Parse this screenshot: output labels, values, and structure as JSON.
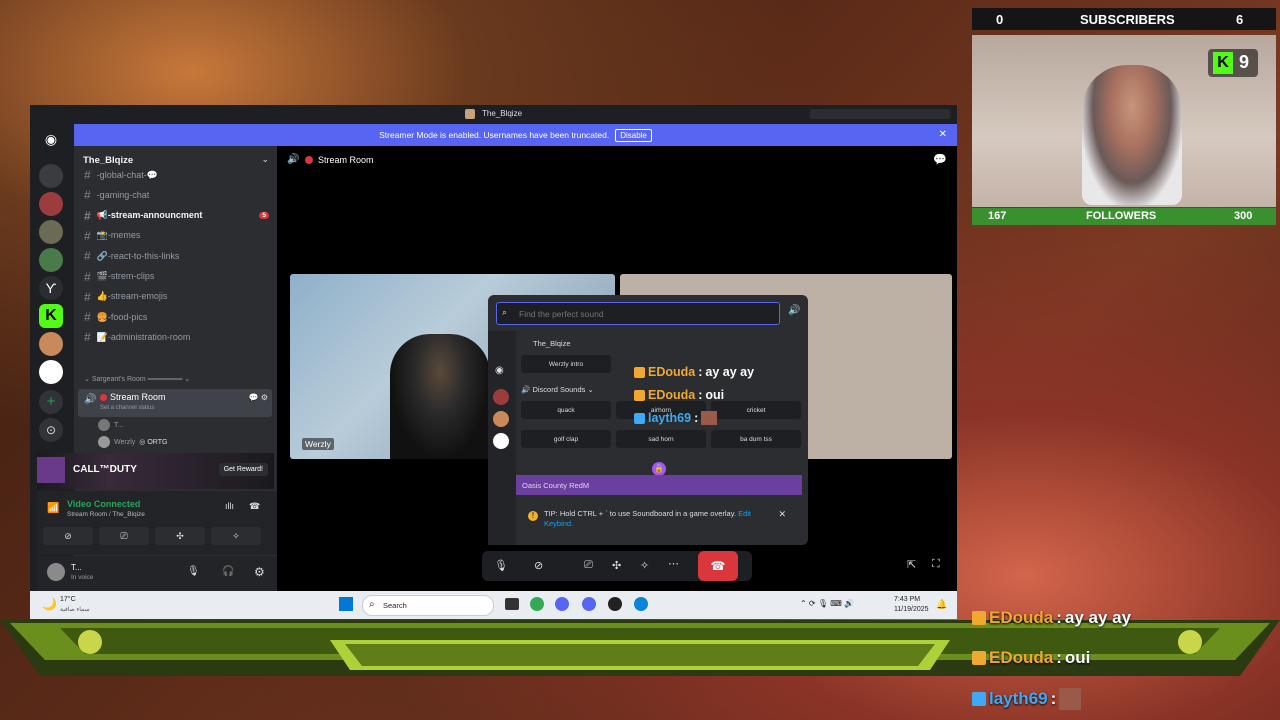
{
  "window_title": "The_Blqize",
  "banner": {
    "text": "Streamer Mode is enabled. Usernames have been truncated.",
    "button": "Disable"
  },
  "server_name": "The_Blqize",
  "channels": [
    {
      "label": "-global-chat-💬",
      "bold": false
    },
    {
      "label": "-gaming-chat",
      "bold": false
    },
    {
      "label": "📢-stream-announcment",
      "bold": true,
      "badge": "5"
    },
    {
      "label": "📸-memes",
      "bold": false
    },
    {
      "label": "🔗-react-to-this-links",
      "bold": false
    },
    {
      "label": "🎬-strem-clips",
      "bold": false
    },
    {
      "label": "👍-stream-emojis",
      "bold": false
    },
    {
      "label": "🍔-food-pics",
      "bold": false
    },
    {
      "label": "📝-administration-room",
      "bold": false
    }
  ],
  "category": "Sargeant's Room",
  "voice_channel": {
    "name": "Stream Room",
    "status": "Set a channel status",
    "users": [
      "T...",
      "Werzly"
    ],
    "user_tag": "ORTG"
  },
  "promo": {
    "title": "CALL™DUTY",
    "button": "Get Reward!"
  },
  "voice_status": {
    "title": "Video Connected",
    "sub": "Stream Room / The_Blqize"
  },
  "user_panel": {
    "name": "T...",
    "status": "In voice"
  },
  "main_header": "Stream Room",
  "video_label": "Werzly",
  "soundboard": {
    "search_placeholder": "Find the perfect sound",
    "section1": "The_Blqize",
    "sound1": "Werzly intro",
    "section2": "Discord Sounds",
    "sounds": [
      "quack",
      "airhorn",
      "cricket",
      "golf clap",
      "sad horn",
      "ba dum tss"
    ],
    "section3": "Oasis County RedM",
    "tip": "TIP: Hold CTRL + ` to use Soundboard in a game overlay.",
    "tip_link": "Edit Keybind."
  },
  "chat": [
    {
      "user": "EDouda",
      "msg": "ay ay ay"
    },
    {
      "user": "EDouda",
      "msg": "oui"
    },
    {
      "user": "layth69",
      "msg": ""
    }
  ],
  "overlay": {
    "subs_left": "0",
    "subs_label": "SUBSCRIBERS",
    "subs_right": "6",
    "fol_left": "167",
    "fol_label": "FOLLOWERS",
    "fol_right": "300",
    "kick_count": "9"
  },
  "taskbar": {
    "weather": "17°C",
    "weather_sub": "سماء صافية",
    "search": "Search",
    "time": "7:43 PM",
    "date": "11/19/2025"
  },
  "colors": {
    "accent": "#5865f2",
    "hangup": "#da373c",
    "green": "#23a55a"
  }
}
